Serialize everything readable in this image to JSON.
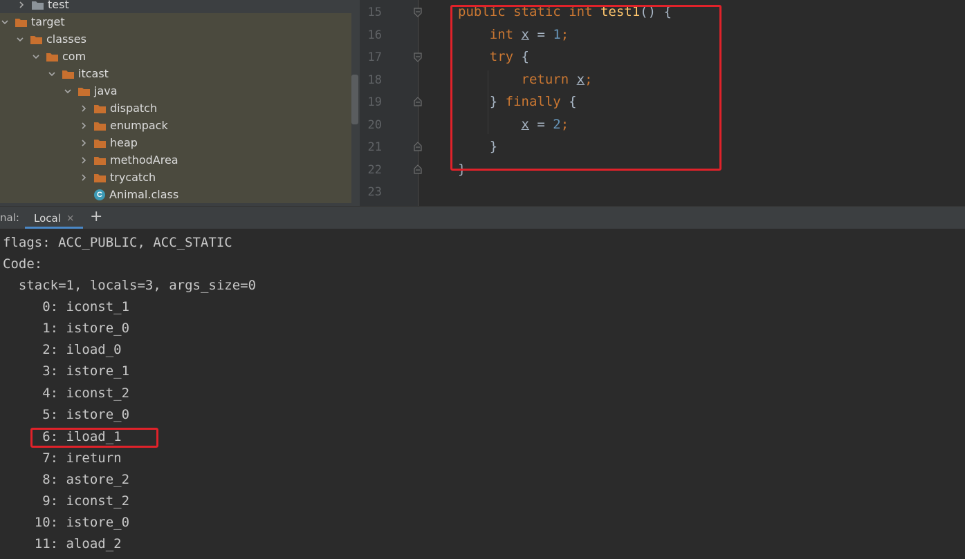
{
  "project_tree": {
    "items": [
      {
        "label": "test",
        "depth": 1,
        "expanded": false,
        "kind": "folder-gray"
      },
      {
        "label": "target",
        "depth": 0,
        "expanded": true,
        "kind": "folder-orange"
      },
      {
        "label": "classes",
        "depth": 1,
        "expanded": true,
        "kind": "folder-orange"
      },
      {
        "label": "com",
        "depth": 2,
        "expanded": true,
        "kind": "folder-orange"
      },
      {
        "label": "itcast",
        "depth": 3,
        "expanded": true,
        "kind": "folder-orange"
      },
      {
        "label": "java",
        "depth": 4,
        "expanded": true,
        "kind": "folder-orange"
      },
      {
        "label": "dispatch",
        "depth": 5,
        "expanded": false,
        "kind": "folder-orange"
      },
      {
        "label": "enumpack",
        "depth": 5,
        "expanded": false,
        "kind": "folder-orange"
      },
      {
        "label": "heap",
        "depth": 5,
        "expanded": false,
        "kind": "folder-orange"
      },
      {
        "label": "methodArea",
        "depth": 5,
        "expanded": false,
        "kind": "folder-orange"
      },
      {
        "label": "trycatch",
        "depth": 5,
        "expanded": false,
        "kind": "folder-orange"
      },
      {
        "label": "Animal.class",
        "depth": 5,
        "expanded": null,
        "kind": "class-file"
      }
    ],
    "class_icon_letter": "C"
  },
  "editor": {
    "line_numbers": [
      "15",
      "16",
      "17",
      "18",
      "19",
      "20",
      "21",
      "22",
      "23"
    ],
    "code": {
      "l15": {
        "kw1": "public",
        "kw2": "static",
        "kw3": "int",
        "fn": "test1",
        "rest": "() {"
      },
      "l16": {
        "kw": "int",
        "var": "x",
        "op": " = ",
        "num": "1",
        "end": ";"
      },
      "l17": {
        "kw": "try",
        "rest": " {"
      },
      "l18": {
        "kw": "return",
        "var": "x",
        "end": ";"
      },
      "l19": {
        "pre": "} ",
        "kw": "finally",
        "rest": " {"
      },
      "l20": {
        "var": "x",
        "op": " = ",
        "num": "2",
        "end": ";"
      },
      "l21": {
        "text": "}"
      },
      "l22": {
        "text": "}"
      }
    }
  },
  "terminal": {
    "title": "nal:",
    "tab_label": "Local",
    "close_glyph": "×",
    "new_tab_glyph": "+",
    "lines": [
      "flags: ACC_PUBLIC, ACC_STATIC",
      "Code:",
      "  stack=1, locals=3, args_size=0",
      "     0: iconst_1",
      "     1: istore_0",
      "     2: iload_0",
      "     3: istore_1",
      "     4: iconst_2",
      "     5: istore_0",
      "     6: iload_1",
      "     7: ireturn",
      "     8: astore_2",
      "     9: iconst_2",
      "    10: istore_0",
      "    11: aload_2"
    ]
  },
  "colors": {
    "accent_box": "#e0222a",
    "keyword": "#cc7832",
    "function": "#ffc66d",
    "number": "#6897bb",
    "folder": "#c8702f",
    "tab_underline": "#4a88c7"
  }
}
